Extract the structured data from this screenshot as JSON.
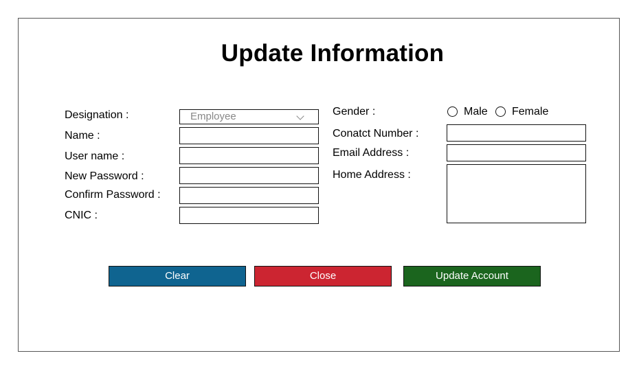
{
  "title": "Update Information",
  "form": {
    "designation_label": "Designation :",
    "designation_value": "Employee",
    "name_label": "Name :",
    "username_label": "User name :",
    "new_password_label": "New Password :",
    "confirm_password_label": "Confirm Password :",
    "cnic_label": "CNIC :",
    "gender_label": "Gender :",
    "gender_options": [
      "Male",
      "Female"
    ],
    "contact_label": "Conatct Number :",
    "email_label": "Email Address :",
    "home_address_label": "Home Address :"
  },
  "buttons": {
    "clear": "Clear",
    "close": "Close",
    "update": "Update Account"
  },
  "colors": {
    "clear": "#0f6490",
    "close": "#cc2531",
    "update": "#1b651e"
  }
}
